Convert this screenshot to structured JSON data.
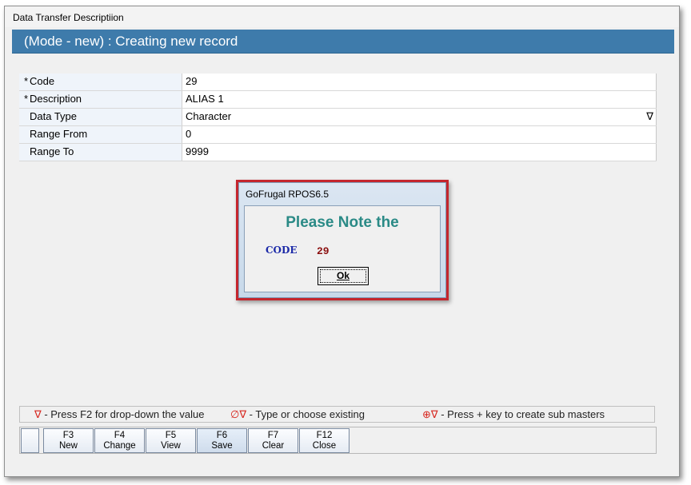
{
  "window": {
    "title": "Data Transfer Descriptiion"
  },
  "header": {
    "mode_text": "(Mode - new) : Creating new record"
  },
  "form": {
    "rows": [
      {
        "required": "*",
        "label": "Code",
        "value": "29"
      },
      {
        "required": "*",
        "label": "Description",
        "value": "ALIAS 1"
      },
      {
        "required": "",
        "label": "Data Type",
        "value": "Character",
        "dropdown_icon": "∇"
      },
      {
        "required": "",
        "label": "Range From",
        "value": "0"
      },
      {
        "required": "",
        "label": "Range To",
        "value": "9999"
      }
    ]
  },
  "dialog": {
    "title": "GoFrugal RPOS6.5",
    "heading": "Please Note the",
    "code_label": "CODE",
    "code_value": "29",
    "ok_label": "Ok",
    "colors": {
      "border": "#c4262e",
      "heading": "#2a8a86",
      "code_label": "#1c2aa8",
      "code_value": "#8b1010"
    }
  },
  "legend": {
    "items": [
      {
        "symbol": "∇",
        "icon": "dropdown-icon",
        "text": " - Press F2 for drop-down the value"
      },
      {
        "symbol": "∅∇",
        "icon": "type-or-choose-icon",
        "text": " - Type or choose existing"
      },
      {
        "symbol": "⊕∇",
        "icon": "create-sub-master-icon",
        "text": " - Press + key to create sub masters"
      }
    ],
    "symbol_color": "#d7261e"
  },
  "function_keys": [
    {
      "key": "F3",
      "label": "New"
    },
    {
      "key": "F4",
      "label": "Change"
    },
    {
      "key": "F5",
      "label": "View"
    },
    {
      "key": "F6",
      "label": "Save"
    },
    {
      "key": "F7",
      "label": "Clear"
    },
    {
      "key": "F12",
      "label": "Close"
    }
  ],
  "colors": {
    "header_bg": "#3e7bab",
    "label_bg": "#eff4fa"
  }
}
